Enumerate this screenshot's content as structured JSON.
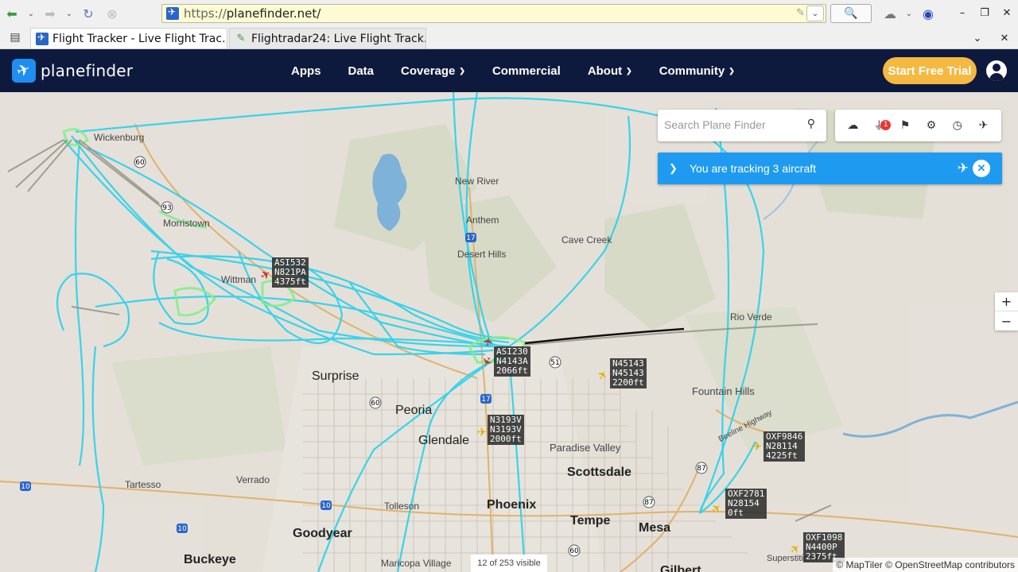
{
  "browser": {
    "url_proto": "https://",
    "url_host": "planefinder.net/",
    "tabs": [
      {
        "label": "Flight Tracker - Live Flight Trac..."
      },
      {
        "label": "Flightradar24: Live Flight Track..."
      }
    ]
  },
  "site": {
    "logo_text": "planefinder",
    "nav": [
      {
        "label": "Apps",
        "dropdown": false
      },
      {
        "label": "Data",
        "dropdown": false
      },
      {
        "label": "Coverage",
        "dropdown": true
      },
      {
        "label": "Commercial",
        "dropdown": false
      },
      {
        "label": "About",
        "dropdown": true
      },
      {
        "label": "Community",
        "dropdown": true
      }
    ],
    "trial_label": "Start Free Trial",
    "brand_color": "#0e1a3d",
    "accent_color": "#f5b941"
  },
  "map": {
    "search_placeholder": "Search Plane Finder",
    "filter_badge": "1",
    "tracking_message": "You are tracking 3 aircraft",
    "zoom_in": "+",
    "zoom_out": "−",
    "visible_count": "12 of 253 visible",
    "attribution": "© MapTiler © OpenStreetMap contributors",
    "places": {
      "wickenburg": "Wickenburg",
      "morristown": "Morristown",
      "wittmann": "Wittman",
      "new_river": "New River",
      "anthem": "Anthem",
      "cave_creek": "Cave Creek",
      "desert_hills": "Desert Hills",
      "rio_verde": "Rio Verde",
      "surprise": "Surprise",
      "peoria": "Peoria",
      "glendale": "Glendale",
      "fountain_hills": "Fountain Hills",
      "paradise_valley": "Paradise Valley",
      "scottsdale": "Scottsdale",
      "tartesso": "Tartesso",
      "verrado": "Verrado",
      "tolleson": "Tolleson",
      "phoenix": "Phoenix",
      "tempe": "Tempe",
      "mesa": "Mesa",
      "goodyear": "Goodyear",
      "buckeye": "Buckeye",
      "maricopa_village": "Maricopa Village",
      "gilbert": "Gilbert",
      "beeline_highway": "Beeline Highway",
      "superstition": "Superstition Fr"
    },
    "route_shields": [
      "60",
      "93",
      "17",
      "51",
      "60",
      "17",
      "10",
      "10",
      "87",
      "87",
      "60",
      "10"
    ],
    "aircraft": [
      {
        "callsign": "ASI532",
        "reg": "N821PA",
        "alt": "4375ft",
        "color": "red"
      },
      {
        "callsign": "ASI230",
        "reg": "N4143A",
        "alt": "2066ft",
        "color": "red"
      },
      {
        "callsign": "N45143",
        "reg": "N45143",
        "alt": "2200ft",
        "color": "yellow"
      },
      {
        "callsign": "N3193V",
        "reg": "N3193V",
        "alt": "2000ft",
        "color": "yellow"
      },
      {
        "callsign": "OXF9846",
        "reg": "N28114",
        "alt": "4225ft",
        "color": "yellow"
      },
      {
        "callsign": "OXF2781",
        "reg": "N28154",
        "alt": "0ft",
        "color": "yellow"
      },
      {
        "callsign": "OXF1098",
        "reg": "N4400P",
        "alt": "2375ft",
        "color": "yellow"
      }
    ]
  }
}
